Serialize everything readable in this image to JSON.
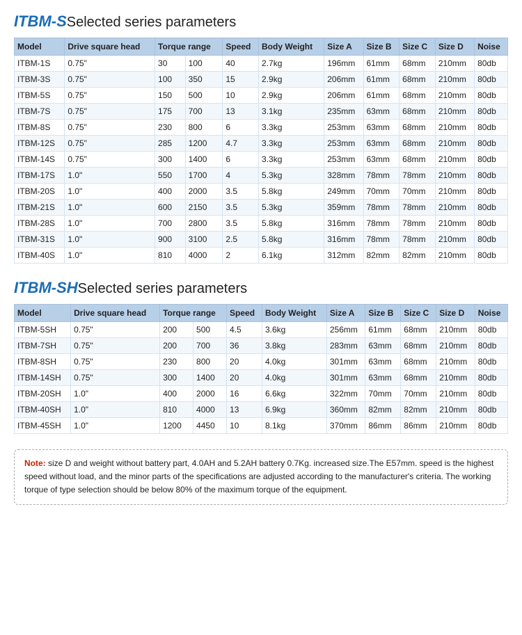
{
  "section1": {
    "brand": "ITBM-S",
    "title": "Selected series parameters",
    "headers": [
      "Model",
      "Drive square head",
      "Torque range",
      "",
      "Speed",
      "Body Weight",
      "Size A",
      "Size B",
      "Size C",
      "Size D",
      "Noise"
    ],
    "rows": [
      [
        "ITBM-1S",
        "0.75\"",
        "30",
        "100",
        "40",
        "2.7kg",
        "196mm",
        "61mm",
        "68mm",
        "210mm",
        "80db"
      ],
      [
        "ITBM-3S",
        "0.75\"",
        "100",
        "350",
        "15",
        "2.9kg",
        "206mm",
        "61mm",
        "68mm",
        "210mm",
        "80db"
      ],
      [
        "ITBM-5S",
        "0.75\"",
        "150",
        "500",
        "10",
        "2.9kg",
        "206mm",
        "61mm",
        "68mm",
        "210mm",
        "80db"
      ],
      [
        "ITBM-7S",
        "0.75\"",
        "175",
        "700",
        "13",
        "3.1kg",
        "235mm",
        "63mm",
        "68mm",
        "210mm",
        "80db"
      ],
      [
        "ITBM-8S",
        "0.75\"",
        "230",
        "800",
        "6",
        "3.3kg",
        "253mm",
        "63mm",
        "68mm",
        "210mm",
        "80db"
      ],
      [
        "ITBM-12S",
        "0.75\"",
        "285",
        "1200",
        "4.7",
        "3.3kg",
        "253mm",
        "63mm",
        "68mm",
        "210mm",
        "80db"
      ],
      [
        "ITBM-14S",
        "0.75\"",
        "300",
        "1400",
        "6",
        "3.3kg",
        "253mm",
        "63mm",
        "68mm",
        "210mm",
        "80db"
      ],
      [
        "ITBM-17S",
        "1.0\"",
        "550",
        "1700",
        "4",
        "5.3kg",
        "328mm",
        "78mm",
        "78mm",
        "210mm",
        "80db"
      ],
      [
        "ITBM-20S",
        "1.0\"",
        "400",
        "2000",
        "3.5",
        "5.8kg",
        "249mm",
        "70mm",
        "70mm",
        "210mm",
        "80db"
      ],
      [
        "ITBM-21S",
        "1.0\"",
        "600",
        "2150",
        "3.5",
        "5.3kg",
        "359mm",
        "78mm",
        "78mm",
        "210mm",
        "80db"
      ],
      [
        "ITBM-28S",
        "1.0\"",
        "700",
        "2800",
        "3.5",
        "5.8kg",
        "316mm",
        "78mm",
        "78mm",
        "210mm",
        "80db"
      ],
      [
        "ITBM-31S",
        "1.0\"",
        "900",
        "3100",
        "2.5",
        "5.8kg",
        "316mm",
        "78mm",
        "78mm",
        "210mm",
        "80db"
      ],
      [
        "ITBM-40S",
        "1.0\"",
        "810",
        "4000",
        "2",
        "6.1kg",
        "312mm",
        "82mm",
        "82mm",
        "210mm",
        "80db"
      ]
    ]
  },
  "section2": {
    "brand": "ITBM-SH",
    "title": "Selected series parameters",
    "headers": [
      "Model",
      "Drive square head",
      "Torque range",
      "",
      "Speed",
      "Body Weight",
      "Size A",
      "Size B",
      "Size C",
      "Size D",
      "Noise"
    ],
    "rows": [
      [
        "ITBM-5SH",
        "0.75\"",
        "200",
        "500",
        "4.5",
        "3.6kg",
        "256mm",
        "61mm",
        "68mm",
        "210mm",
        "80db"
      ],
      [
        "ITBM-7SH",
        "0.75\"",
        "200",
        "700",
        "36",
        "3.8kg",
        "283mm",
        "63mm",
        "68mm",
        "210mm",
        "80db"
      ],
      [
        "ITBM-8SH",
        "0.75\"",
        "230",
        "800",
        "20",
        "4.0kg",
        "301mm",
        "63mm",
        "68mm",
        "210mm",
        "80db"
      ],
      [
        "ITBM-14SH",
        "0.75\"",
        "300",
        "1400",
        "20",
        "4.0kg",
        "301mm",
        "63mm",
        "68mm",
        "210mm",
        "80db"
      ],
      [
        "ITBM-20SH",
        "1.0\"",
        "400",
        "2000",
        "16",
        "6.6kg",
        "322mm",
        "70mm",
        "70mm",
        "210mm",
        "80db"
      ],
      [
        "ITBM-40SH",
        "1.0\"",
        "810",
        "4000",
        "13",
        "6.9kg",
        "360mm",
        "82mm",
        "82mm",
        "210mm",
        "80db"
      ],
      [
        "ITBM-45SH",
        "1.0\"",
        "1200",
        "4450",
        "10",
        "8.1kg",
        "370mm",
        "86mm",
        "86mm",
        "210mm",
        "80db"
      ]
    ]
  },
  "note": {
    "label": "Note:",
    "text": " size D and weight without battery part, 4.0AH and 5.2AH battery 0.7Kg. increased size.The E57mm. speed is the highest speed without load, and the minor parts of the specifications are adjusted according to the manufacturer's criteria.\nThe working torque of type selection should be below 80% of the maximum torque of the equipment."
  },
  "col_headers": {
    "model": "Model",
    "drive": "Drive square head",
    "torque": "Torque range",
    "speed": "Speed",
    "weight": "Body Weight",
    "sizeA": "Size A",
    "sizeB": "Size B",
    "sizeC": "Size C",
    "sizeD": "Size D",
    "noise": "Noise"
  }
}
